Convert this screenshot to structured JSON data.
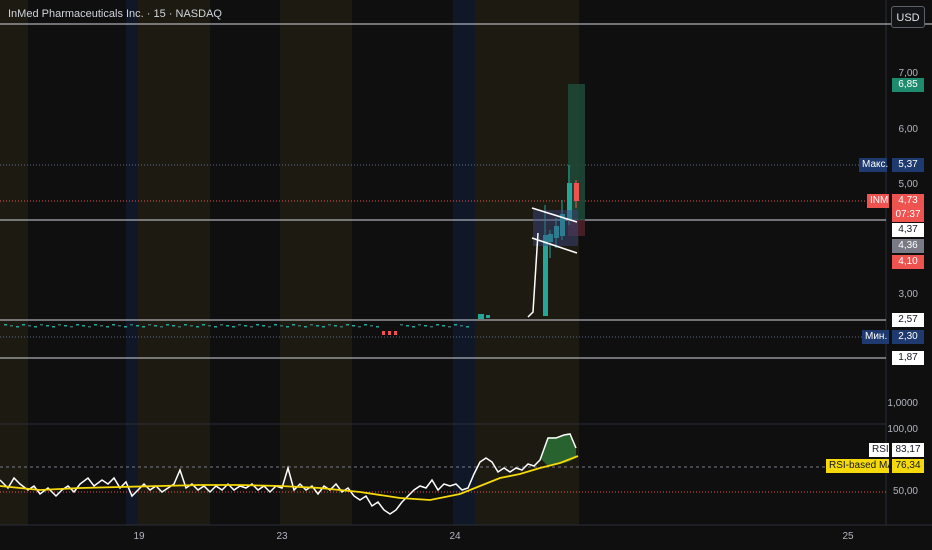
{
  "header": {
    "title": "InMed Pharmaceuticals Inc. · 15 · NASDAQ",
    "currency_button": "USD"
  },
  "price_axis": {
    "ticks": [
      "7,00",
      "6,00",
      "5,00",
      "3,00",
      "1,0000",
      "100,00",
      "50,00"
    ]
  },
  "time_axis": {
    "ticks": [
      "19",
      "23",
      "24",
      "25"
    ]
  },
  "price_labels": {
    "target": "6,85",
    "max_tag": "Макс.",
    "max_value": "5,37",
    "symbol": "INM",
    "last_price": "4,73",
    "countdown": "07:37",
    "level_1": "4,37",
    "level_2": "4,36",
    "level_3": "4,10",
    "level_4": "2,57",
    "min_tag": "Мин.",
    "min_value": "2,30",
    "level_5": "1,87"
  },
  "rsi": {
    "rsi_tag": "RSI",
    "rsi_value": "83,17",
    "ma_tag": "RSI-based MA",
    "ma_value": "76,34"
  },
  "colors": {
    "background": "#0f0f10",
    "up": "#26a69a",
    "down": "#ef5350",
    "session_pre": "#1f1c10",
    "session_post": "#121a2a",
    "rsi_ma": "#f5d90a"
  }
}
